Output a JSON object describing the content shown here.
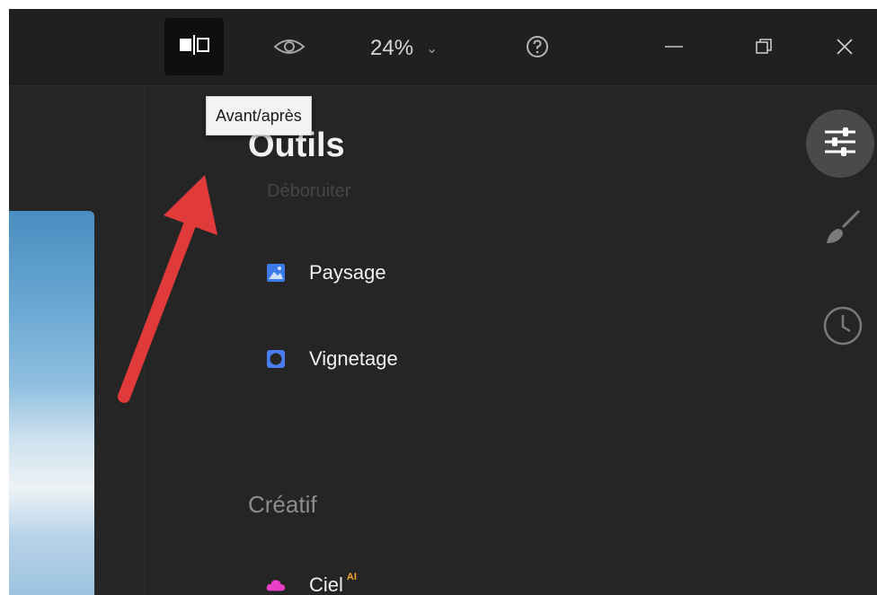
{
  "toolbar": {
    "compare_icon": "before-after-icon",
    "view_icon": "eye-icon",
    "zoom_value": "24%",
    "zoom_caret": "⌄",
    "help_icon": "help-icon",
    "window_controls": {
      "minimize_icon": "minimize-icon",
      "maximize_icon": "restore-icon",
      "close_icon": "close-icon"
    }
  },
  "tooltip": {
    "text": "Avant/après"
  },
  "panel": {
    "title": "Outils",
    "partially_hidden_item": "Déboruiter",
    "items": [
      {
        "label": "Paysage",
        "icon": "landscape-icon",
        "icon_color": "#3b7ae8"
      },
      {
        "label": "Vignetage",
        "icon": "vignette-icon",
        "icon_color": "#4a7df0"
      }
    ],
    "section_creatif": {
      "label": "Créatif",
      "items": [
        {
          "label": "Ciel",
          "badge": "AI",
          "icon": "cloud-icon",
          "icon_color": "#e83ec8"
        }
      ]
    }
  },
  "right_rail": {
    "items": [
      {
        "icon": "adjustments-icon",
        "active": true
      },
      {
        "icon": "brush-icon",
        "active": false
      },
      {
        "icon": "history-clock-icon",
        "active": false
      }
    ]
  },
  "colors": {
    "background": "#252525",
    "titlebar": "#202020",
    "annotation_arrow": "#e03a3a",
    "accent_blue": "#3b7ae8",
    "accent_pink": "#e83ec8",
    "ai_badge": "#f5a623"
  }
}
